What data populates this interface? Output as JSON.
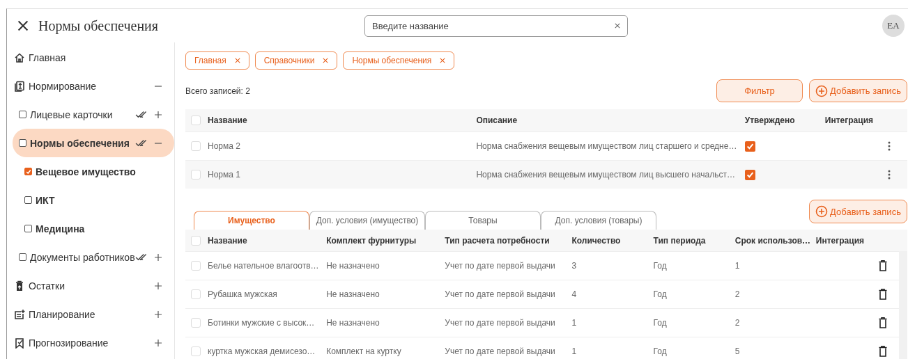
{
  "header": {
    "title": "Нормы обеспечения",
    "search": {
      "placeholder": "Введите название"
    },
    "avatar": "EA"
  },
  "sidebar": {
    "items": [
      {
        "label": "Главная",
        "kind": "section"
      },
      {
        "label": "Нормирование",
        "kind": "section",
        "expanded": true,
        "children": [
          {
            "label": "Лицевые карточки",
            "kind": "group",
            "checked": false,
            "selected": false,
            "expanded": false
          },
          {
            "label": "Нормы обеспечения",
            "kind": "group",
            "checked": false,
            "selected": true,
            "expanded": true,
            "children": [
              {
                "label": "Вещевое имущество",
                "kind": "leaf",
                "checked": true
              },
              {
                "label": "ИКТ",
                "kind": "leaf",
                "checked": false
              },
              {
                "label": "Медицина",
                "kind": "leaf",
                "checked": false
              }
            ]
          },
          {
            "label": "Документы работников",
            "kind": "group",
            "checked": false,
            "selected": false,
            "expanded": false
          }
        ]
      },
      {
        "label": "Остатки",
        "kind": "section",
        "expanded": false
      },
      {
        "label": "Планирование",
        "kind": "section",
        "expanded": false
      },
      {
        "label": "Прогнозирование",
        "kind": "section",
        "expanded": false
      }
    ]
  },
  "breadcrumbs": [
    {
      "label": "Главная"
    },
    {
      "label": "Справочники"
    },
    {
      "label": "Нормы обеспечения"
    }
  ],
  "records_total": "Всего записей: 2",
  "toolbar": {
    "buttons": [
      {
        "label": "Фильтр",
        "kind": "plain"
      },
      {
        "label": "Добавить запись",
        "kind": "add"
      }
    ]
  },
  "norms_table": {
    "all_selected": false,
    "columns": [
      "Название",
      "Описание",
      "Утверждено",
      "Интеграция"
    ],
    "rows": [
      {
        "selected": false,
        "name": "Норма 2",
        "description": "Норма снабжения вещевым имуществом лиц старшего и средне…",
        "approved": true
      },
      {
        "selected": false,
        "name": "Норма 1",
        "description": "Норма снабжения вещевым имуществом лиц высшего начальст…",
        "approved": true
      }
    ]
  },
  "detail": {
    "tabs": [
      {
        "label": "Имущество",
        "selected": true
      },
      {
        "label": "Доп. условия (имущество)",
        "selected": false
      },
      {
        "label": "Товары",
        "selected": false
      },
      {
        "label": "Доп. условия (товары)",
        "selected": false
      }
    ],
    "add_button": "Добавить запись",
    "table": {
      "all_selected": false,
      "columns": [
        "Название",
        "Комплект фурнитуры",
        "Тип расчета потребности",
        "Количество",
        "Тип периода",
        "Срок использов…",
        "Интеграция"
      ],
      "rows": [
        {
          "selected": false,
          "cells": [
            "Белье нательное влагоотв…",
            "Не назначено",
            "Учет по дате первой выдачи",
            "3",
            "Год",
            "1"
          ]
        },
        {
          "selected": false,
          "cells": [
            "Рубашка мужская",
            "Не назначено",
            "Учет по дате первой выдачи",
            "4",
            "Год",
            "2"
          ]
        },
        {
          "selected": false,
          "cells": [
            "Ботинки мужские с высок…",
            "Не назначено",
            "Учет по дате первой выдачи",
            "1",
            "Год",
            "2"
          ]
        },
        {
          "selected": false,
          "cells": [
            "куртка мужская демисезо…",
            "Комплект на куртку",
            "Учет по дате первой выдачи",
            "1",
            "Год",
            "5"
          ]
        }
      ]
    }
  }
}
